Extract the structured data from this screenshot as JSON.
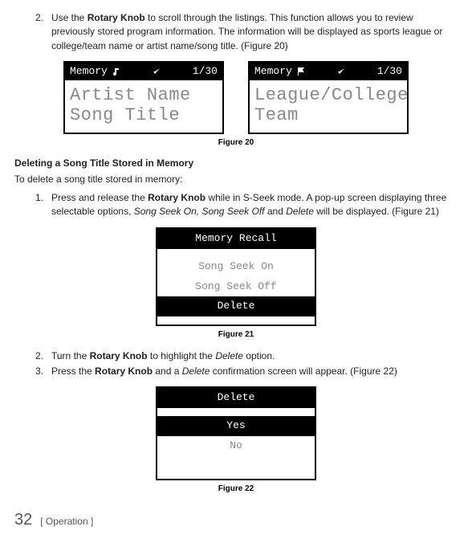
{
  "step2": {
    "num": "2.",
    "text_a": "Use the ",
    "text_b": "Rotary Knob",
    "text_c": " to scroll through the listings. This function allows you to review previously stored program information. The information will be displayed as sports league or college/team name or artist name/song title. (Figure 20)"
  },
  "screen_left": {
    "title": "Memory",
    "count": "1/30",
    "line1": "Artist Name",
    "line2": "Song Title"
  },
  "screen_right": {
    "title": "Memory",
    "count": "1/30",
    "line1": "League/College",
    "line2": "Team"
  },
  "fig20": "Figure 20",
  "heading_del": "Deleting a Song Title Stored in Memory",
  "intro_del": "To delete a song title stored in memory:",
  "del_step1": {
    "num": "1.",
    "a": "Press and release the ",
    "b": "Rotary Knob",
    "c": " while in S-Seek mode.  A pop-up screen displaying three selectable options, ",
    "d": "Song Seek On, Song Seek Off",
    "e": " and ",
    "f": "Delete",
    "g": " will be displayed. (Figure 21)"
  },
  "screen_recall": {
    "title": "Memory Recall",
    "opt1": "Song Seek On",
    "opt2": "Song Seek Off",
    "opt3": "Delete"
  },
  "fig21": "Figure 21",
  "del_step2": {
    "num": "2.",
    "a": "Turn the ",
    "b": "Rotary Knob",
    "c": " to highlight the ",
    "d": "Delete",
    "e": " option."
  },
  "del_step3": {
    "num": "3.",
    "a": "Press the ",
    "b": "Rotary Knob",
    "c": " and a ",
    "d": "Delete",
    "e": " confirmation screen will appear. (Figure 22)"
  },
  "screen_delete": {
    "title": "Delete",
    "yes": "Yes",
    "no": "No"
  },
  "fig22": "Figure 22",
  "footer": {
    "page": "32",
    "section": "[ Operation ]"
  }
}
